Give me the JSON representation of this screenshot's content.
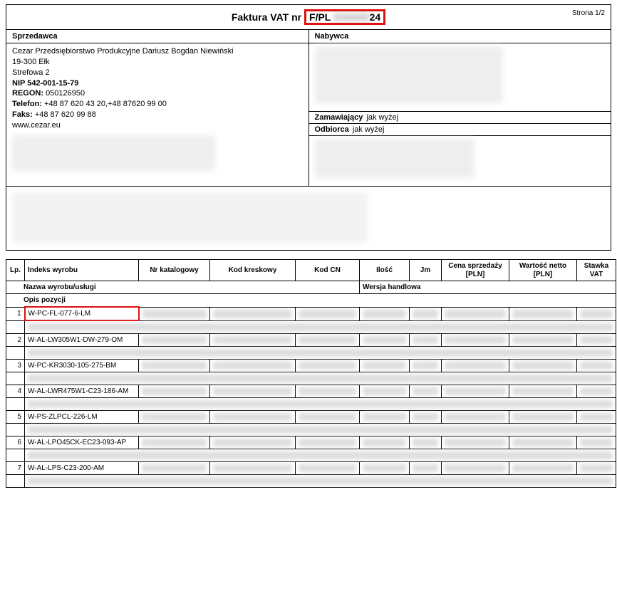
{
  "header": {
    "title_prefix": "Faktura VAT nr",
    "invoice_no_prefix": "F/PL",
    "invoice_no_suffix": "24",
    "page": "Strona 1/2"
  },
  "seller": {
    "heading": "Sprzedawca",
    "name": "Cezar Przedsiębiorstwo Produkcyjne Dariusz Bogdan Niewiński",
    "city": "19-300 Ełk",
    "street": "Strefowa 2",
    "nip_label": "NIP",
    "nip": "542-001-15-79",
    "regon_label": "REGON:",
    "regon": "050126950",
    "phone_label": "Telefon:",
    "phone": "+48 87 620 43 20,+48 87620 99 00",
    "fax_label": "Faks:",
    "fax": "+48 87 620 99 88",
    "www": "www.cezar.eu"
  },
  "buyer": {
    "heading": "Nabywca",
    "orderer_label": "Zamawiający",
    "orderer_value": "jak wyżej",
    "recipient_label": "Odbiorca",
    "recipient_value": "jak wyżej"
  },
  "items_header": {
    "lp": "Lp.",
    "indeks": "Indeks wyrobu",
    "katalog": "Nr katalogowy",
    "kreskowy": "Kod kreskowy",
    "cn": "Kod CN",
    "ilosc": "Ilość",
    "jm": "Jm",
    "cena": "Cena sprzedaży [PLN]",
    "wartosc": "Wartość netto [PLN]",
    "stawka": "Stawka VAT",
    "nazwa": "Nazwa wyrobu/usługi",
    "wersja": "Wersja handlowa",
    "opis": "Opis pozycji"
  },
  "items": [
    {
      "lp": "1",
      "code": "W-PC-FL-077-6-LM",
      "highlight": true
    },
    {
      "lp": "2",
      "code": "W-AL-LW305W1-DW-279-OM",
      "highlight": false
    },
    {
      "lp": "3",
      "code": "W-PC-KR3030-105-275-BM",
      "highlight": false
    },
    {
      "lp": "4",
      "code": "W-AL-LWR475W1-C23-186-AM",
      "highlight": false
    },
    {
      "lp": "5",
      "code": "W-PS-ZLPCL-226-LM",
      "highlight": false
    },
    {
      "lp": "6",
      "code": "W-AL-LPO45CK-EC23-093-AP",
      "highlight": false
    },
    {
      "lp": "7",
      "code": "W-AL-LPS-C23-200-AM",
      "highlight": false
    }
  ]
}
